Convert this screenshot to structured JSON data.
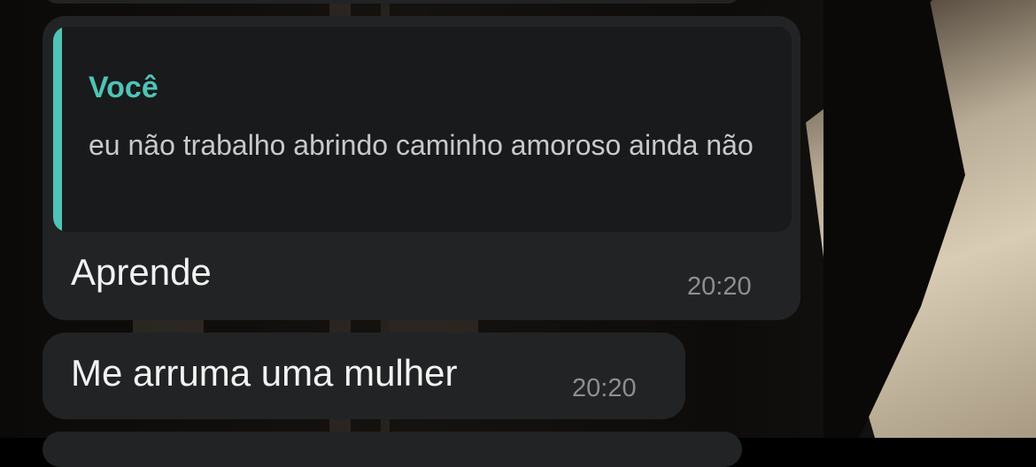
{
  "theme": {
    "bubble_color": "#222324",
    "quote_background": "#191a1b",
    "accent_color": "#4fc3b6",
    "text_color": "#f2f2f2",
    "time_color": "#8e8e8e"
  },
  "messages": [
    {
      "reply": {
        "author": "Você",
        "text": "eu não trabalho abrindo caminho amoroso ainda não"
      },
      "text": "Aprende",
      "time": "20:20"
    },
    {
      "text": "Me arruma uma mulher",
      "time": "20:20"
    }
  ]
}
